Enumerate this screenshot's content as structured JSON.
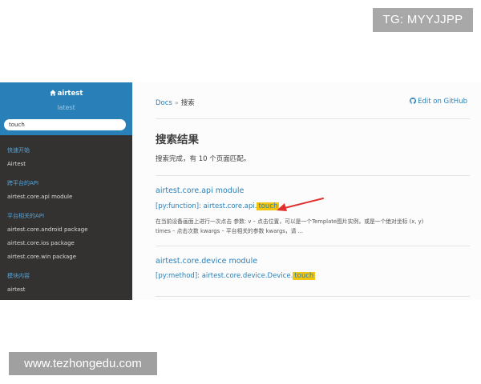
{
  "watermarks": {
    "top": "TG: MYYJJPP",
    "bottom": "www.tezhongedu.com"
  },
  "sidebar": {
    "brand": "airtest",
    "version": "latest",
    "search_value": "touch",
    "sections": [
      {
        "caption": "快速开始",
        "items": [
          "Airtest"
        ]
      },
      {
        "caption": "跨平台的API",
        "items": [
          "airtest.core.api module"
        ]
      },
      {
        "caption": "平台相关的API",
        "items": [
          "airtest.core.android package",
          "airtest.core.ios package",
          "airtest.core.win package"
        ]
      },
      {
        "caption": "模块内容",
        "items": [
          "airtest"
        ]
      }
    ]
  },
  "content": {
    "breadcrumb": {
      "root": "Docs",
      "separator": "»",
      "current": "搜索"
    },
    "edit_link": "Edit on GitHub",
    "title": "搜索结果",
    "summary": "搜索完成，有 10 个页面匹配。",
    "results": [
      {
        "title": "airtest.core.api module",
        "context_prefix": "[py:function]: airtest.core.api.",
        "context_match": "touch",
        "snippet_lines": [
          "在当前设备画面上进行一次点击 参数: v – 点击位置，可以是一个Template图片实例，或是一个绝对坐标 (x, y)",
          "times – 点击次数 kwargs – 平台相关的参数 kwargs，请 ..."
        ]
      },
      {
        "title": "airtest.core.device module",
        "context_prefix": "[py:method]: airtest.core.device.Device.",
        "context_match": "touch",
        "snippet_lines": []
      }
    ]
  },
  "colors": {
    "accent": "#2980b9",
    "sidebar_bg": "#343131",
    "highlight": "#f1c40f",
    "arrow": "#e0312f"
  }
}
